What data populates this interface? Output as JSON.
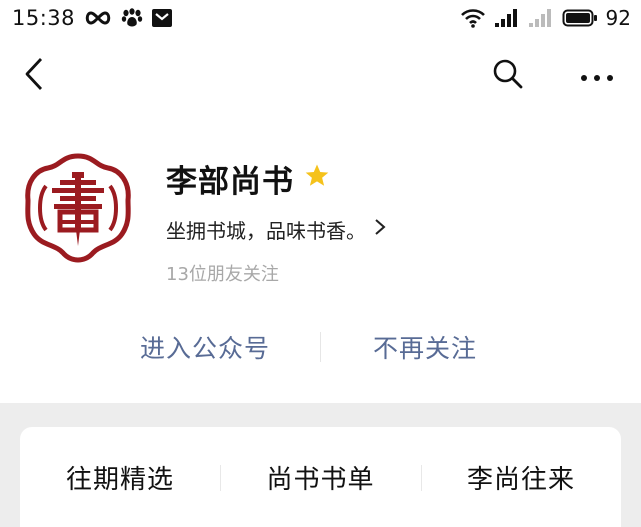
{
  "status_bar": {
    "time": "15:38",
    "battery_percent": "92",
    "left_icons": [
      "infinity-icon",
      "paw-icon",
      "mail-icon"
    ],
    "right_icons": [
      "wifi-icon",
      "signal-icon",
      "signal-icon",
      "battery-icon"
    ]
  },
  "nav": {
    "back_icon": "chevron-left-icon",
    "search_icon": "search-icon",
    "more_icon": "more-icon"
  },
  "profile": {
    "name": "李部尚书",
    "description": "坐拥书城，品味书香。",
    "followers": "13位朋友关注",
    "star_color": "#f5c21b",
    "avatar_color": "#9b1b20"
  },
  "actions": {
    "enter": "进入公众号",
    "unfollow": "不再关注",
    "color": "#586b95"
  },
  "menu": {
    "items": [
      "往期精选",
      "尚书书单",
      "李尚往来"
    ]
  }
}
